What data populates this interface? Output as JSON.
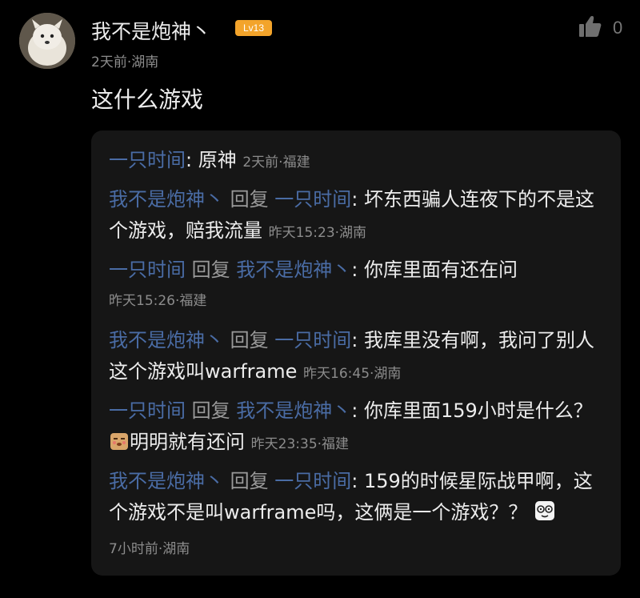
{
  "comment": {
    "username": "我不是炮神丶",
    "level": "Lv13",
    "meta": "2天前·湖南",
    "text": "这什么游戏",
    "like_count": "0"
  },
  "replies": [
    {
      "author": "一只时间",
      "reply_word": "",
      "target": "",
      "text": "原神",
      "meta": "2天前·福建"
    },
    {
      "author": "我不是炮神丶",
      "reply_word": "回复",
      "target": "一只时间",
      "text": "坏东西骗人连夜下的不是这个游戏，赔我流量",
      "meta": "昨天15:23·湖南"
    },
    {
      "author": "一只时间",
      "reply_word": "回复",
      "target": "我不是炮神丶",
      "text": "你库里面有还在问",
      "meta": "昨天15:26·福建"
    },
    {
      "author": "我不是炮神丶",
      "reply_word": "回复",
      "target": "一只时间",
      "text": "我库里没有啊，我问了别人这个游戏叫warframe",
      "meta": "昨天16:45·湖南"
    },
    {
      "author": "一只时间",
      "reply_word": "回复",
      "target": "我不是炮神丶",
      "text_before": "你库里面159小时是什么？",
      "emoji": "shy-face-emoji",
      "text_after": "明明就有还问",
      "meta": "昨天23:35·福建"
    },
    {
      "author": "我不是炮神丶",
      "reply_word": "回复",
      "target": "一只时间",
      "text": "159的时候星际战甲啊，这个游戏不是叫warframe吗，这俩是一个游戏？？",
      "emoji": "dizzy-face-emoji",
      "meta": "7小时前·湖南"
    }
  ],
  "colors": {
    "background": "#000000",
    "reply_box": "#161616",
    "name_link": "#4a6ca5",
    "badge": "#f3a42b",
    "meta": "#8c8c8c"
  },
  "icons": [
    "avatar-dog",
    "thumbs-up-icon"
  ]
}
